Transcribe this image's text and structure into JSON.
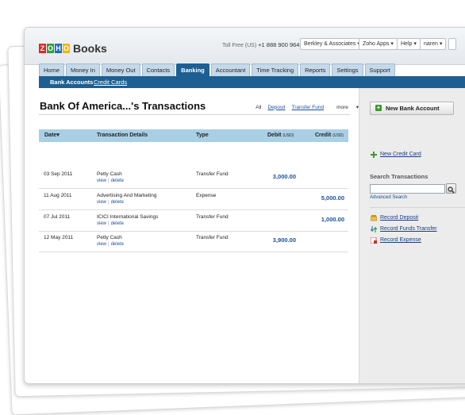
{
  "app": {
    "logo_letters": [
      "Z",
      "O",
      "H",
      "O"
    ],
    "logo_colors": [
      "#e42527",
      "#2e9e3f",
      "#1e6fbd",
      "#f2b705"
    ],
    "name": "Books",
    "toll_free_label": "Toll Free (US)",
    "toll_free_number": "+1 888 900 9646"
  },
  "header": {
    "org_dropdown": "Berkley & Associates",
    "apps_dropdown": "Zoho Apps",
    "help_dropdown": "Help",
    "user_dropdown": "naren"
  },
  "tabs": [
    {
      "label": "Home",
      "active": false
    },
    {
      "label": "Money In",
      "active": false
    },
    {
      "label": "Money Out",
      "active": false
    },
    {
      "label": "Contacts",
      "active": false
    },
    {
      "label": "Banking",
      "active": true
    },
    {
      "label": "Accountant",
      "active": false
    },
    {
      "label": "Time Tracking",
      "active": false
    },
    {
      "label": "Reports",
      "active": false
    },
    {
      "label": "Settings",
      "active": false
    },
    {
      "label": "Support",
      "active": false
    }
  ],
  "subnav": {
    "bank_accounts": "Bank Accounts",
    "credit_cards": "Credit Cards"
  },
  "page": {
    "title": "Bank Of America...'s Transactions",
    "filters": {
      "all": "All",
      "deposit": "Deposit",
      "transfer_fund": "Transfer Fund",
      "more": "more"
    }
  },
  "table": {
    "headers": {
      "date": "Date",
      "details": "Transaction Details",
      "type": "Type",
      "debit": "Debit",
      "debit_unit": "(USD)",
      "credit": "Credit",
      "credit_unit": "(USD)"
    },
    "action_view": "view",
    "action_delete": "delete",
    "rows": [
      {
        "date": "03 Sep 2011",
        "details": "Petty Cash",
        "type": "Transfer Fund",
        "debit": "3,000.00",
        "credit": ""
      },
      {
        "date": "11 Aug 2011",
        "details": "Advertising And Marketing",
        "type": "Expense",
        "debit": "",
        "credit": "5,000.00"
      },
      {
        "date": "07 Jul 2011",
        "details": "ICICI International Savings",
        "type": "Transfer Fund",
        "debit": "",
        "credit": "1,000.00"
      },
      {
        "date": "12 May 2011",
        "details": "Petty Cash",
        "type": "Transfer Fund",
        "debit": "3,900.00",
        "credit": ""
      }
    ]
  },
  "sidebar": {
    "new_bank_account": "New Bank Account",
    "new_credit_card": "New Credit Card",
    "search_heading": "Search Transactions",
    "search_value": "",
    "advanced_search": "Advanced Search",
    "record_deposit": "Record Deposit",
    "record_funds_transfer": "Record Funds Transfer",
    "record_expense": "Record Expense"
  },
  "colors": {
    "accent_blue": "#1d5f92",
    "table_header": "#a9cfe5",
    "link": "#1a4f9a"
  }
}
